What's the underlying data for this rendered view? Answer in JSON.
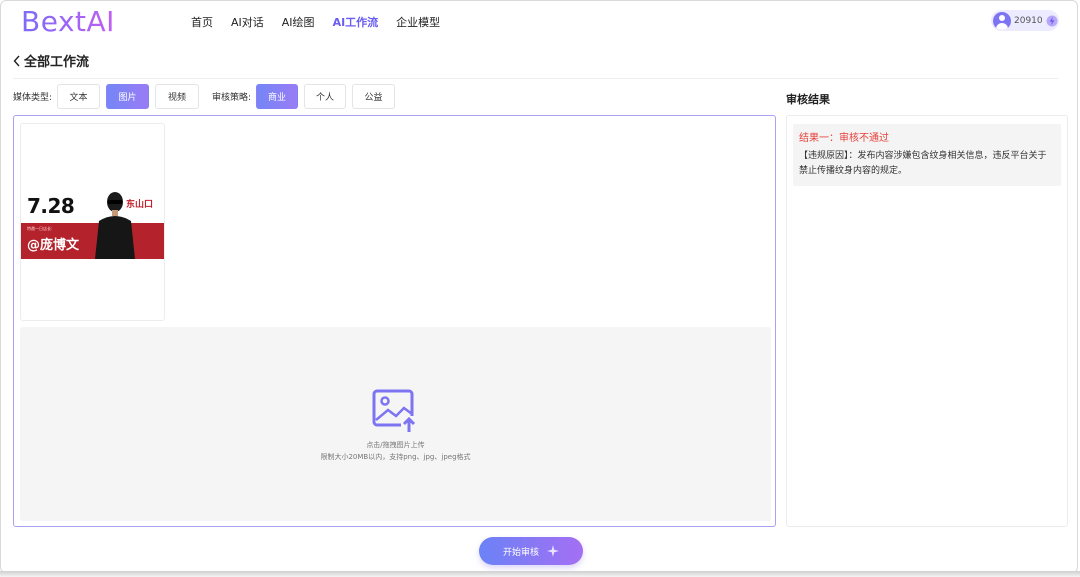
{
  "app": {
    "logo": "BextAI"
  },
  "nav": {
    "items": [
      {
        "label": "首页",
        "active": false
      },
      {
        "label": "AI对话",
        "active": false
      },
      {
        "label": "AI绘图",
        "active": false
      },
      {
        "label": "AI工作流",
        "active": true
      },
      {
        "label": "企业模型",
        "active": false
      }
    ]
  },
  "user": {
    "credits": "20910",
    "icons": [
      "avatar-icon",
      "credit-icon"
    ]
  },
  "page": {
    "back_title": "全部工作流",
    "back_icon": "chevron-left-icon"
  },
  "filters": {
    "media": {
      "label": "媒体类型:",
      "options": [
        "文本",
        "图片",
        "视频"
      ],
      "selected": "图片"
    },
    "policy": {
      "label": "审核策略:",
      "options": [
        "商业",
        "个人",
        "公益"
      ],
      "selected": "商业"
    }
  },
  "uploaded_image": {
    "date": "7.28",
    "place": "东山口",
    "guest_line": "特邀一日店长:",
    "name": "@庞博文"
  },
  "upload": {
    "icon": "image-upload-icon",
    "hint": "点击/拖拽图片上传",
    "limits": "限制大小20MB以内，支持png、jpg、jpeg格式"
  },
  "result": {
    "title": "审核结果",
    "head": "结果一：审核不通过",
    "reason": "【违规原因】：发布内容涉嫌包含纹身相关信息，违反平台关于禁止传播纹身内容的规定。"
  },
  "actions": {
    "start_label": "开始审核",
    "start_icon": "sparkle-icon"
  },
  "colors": {
    "accent": "#6a5df0",
    "danger": "#e5403a",
    "poster_red": "#b4232c"
  }
}
